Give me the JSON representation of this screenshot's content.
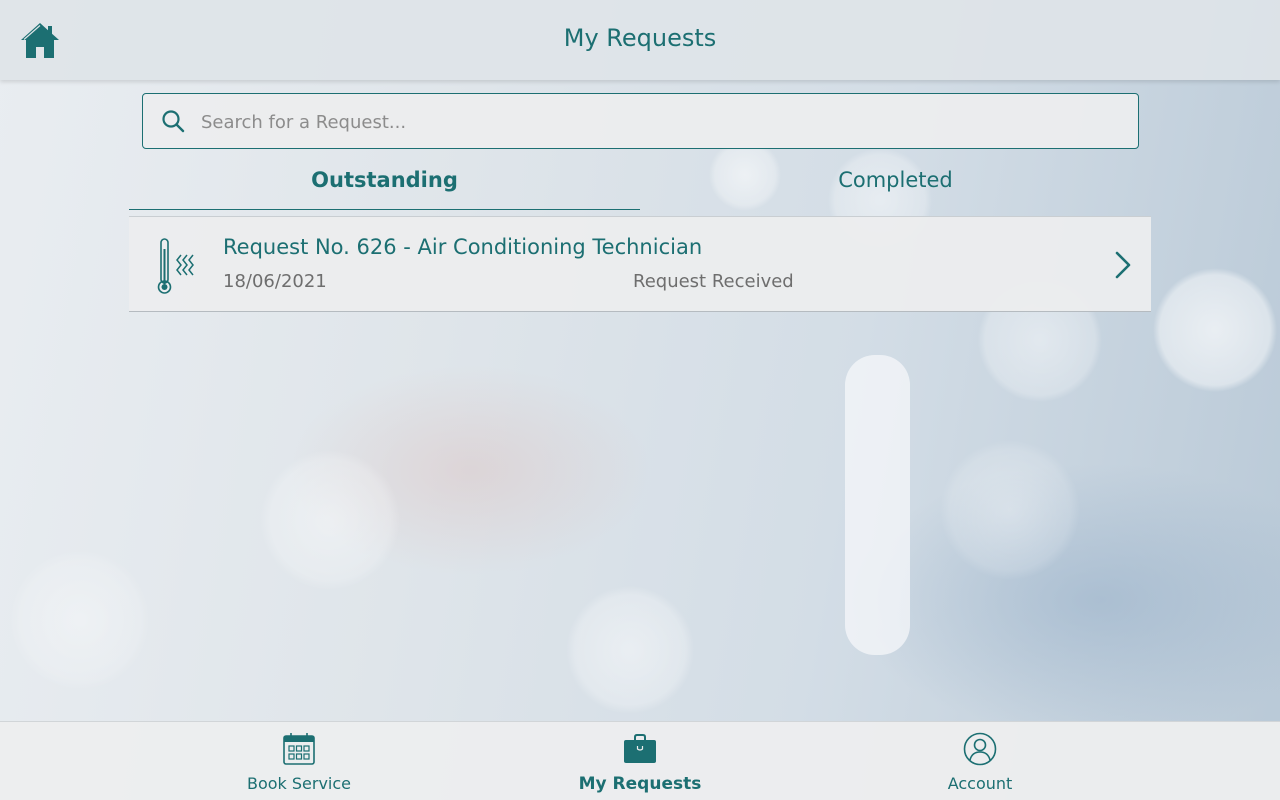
{
  "header": {
    "title": "My Requests",
    "home_icon": "home-icon"
  },
  "search": {
    "placeholder": "Search for a Request...",
    "value": "",
    "icon": "search-icon"
  },
  "tabs": [
    {
      "label": "Outstanding",
      "active": true
    },
    {
      "label": "Completed",
      "active": false
    }
  ],
  "requests": [
    {
      "icon": "thermometer-icon",
      "title": "Request No. 626 - Air Conditioning Technician",
      "date": "18/06/2021",
      "status": "Request Received"
    }
  ],
  "bottom_nav": [
    {
      "label": "Book Service",
      "icon": "calendar-icon",
      "active": false
    },
    {
      "label": "My Requests",
      "icon": "briefcase-icon",
      "active": true
    },
    {
      "label": "Account",
      "icon": "user-icon",
      "active": false
    }
  ],
  "colors": {
    "accent": "#1c6f72",
    "muted_text": "#6e6e6e",
    "bar_background": "#eceded"
  }
}
